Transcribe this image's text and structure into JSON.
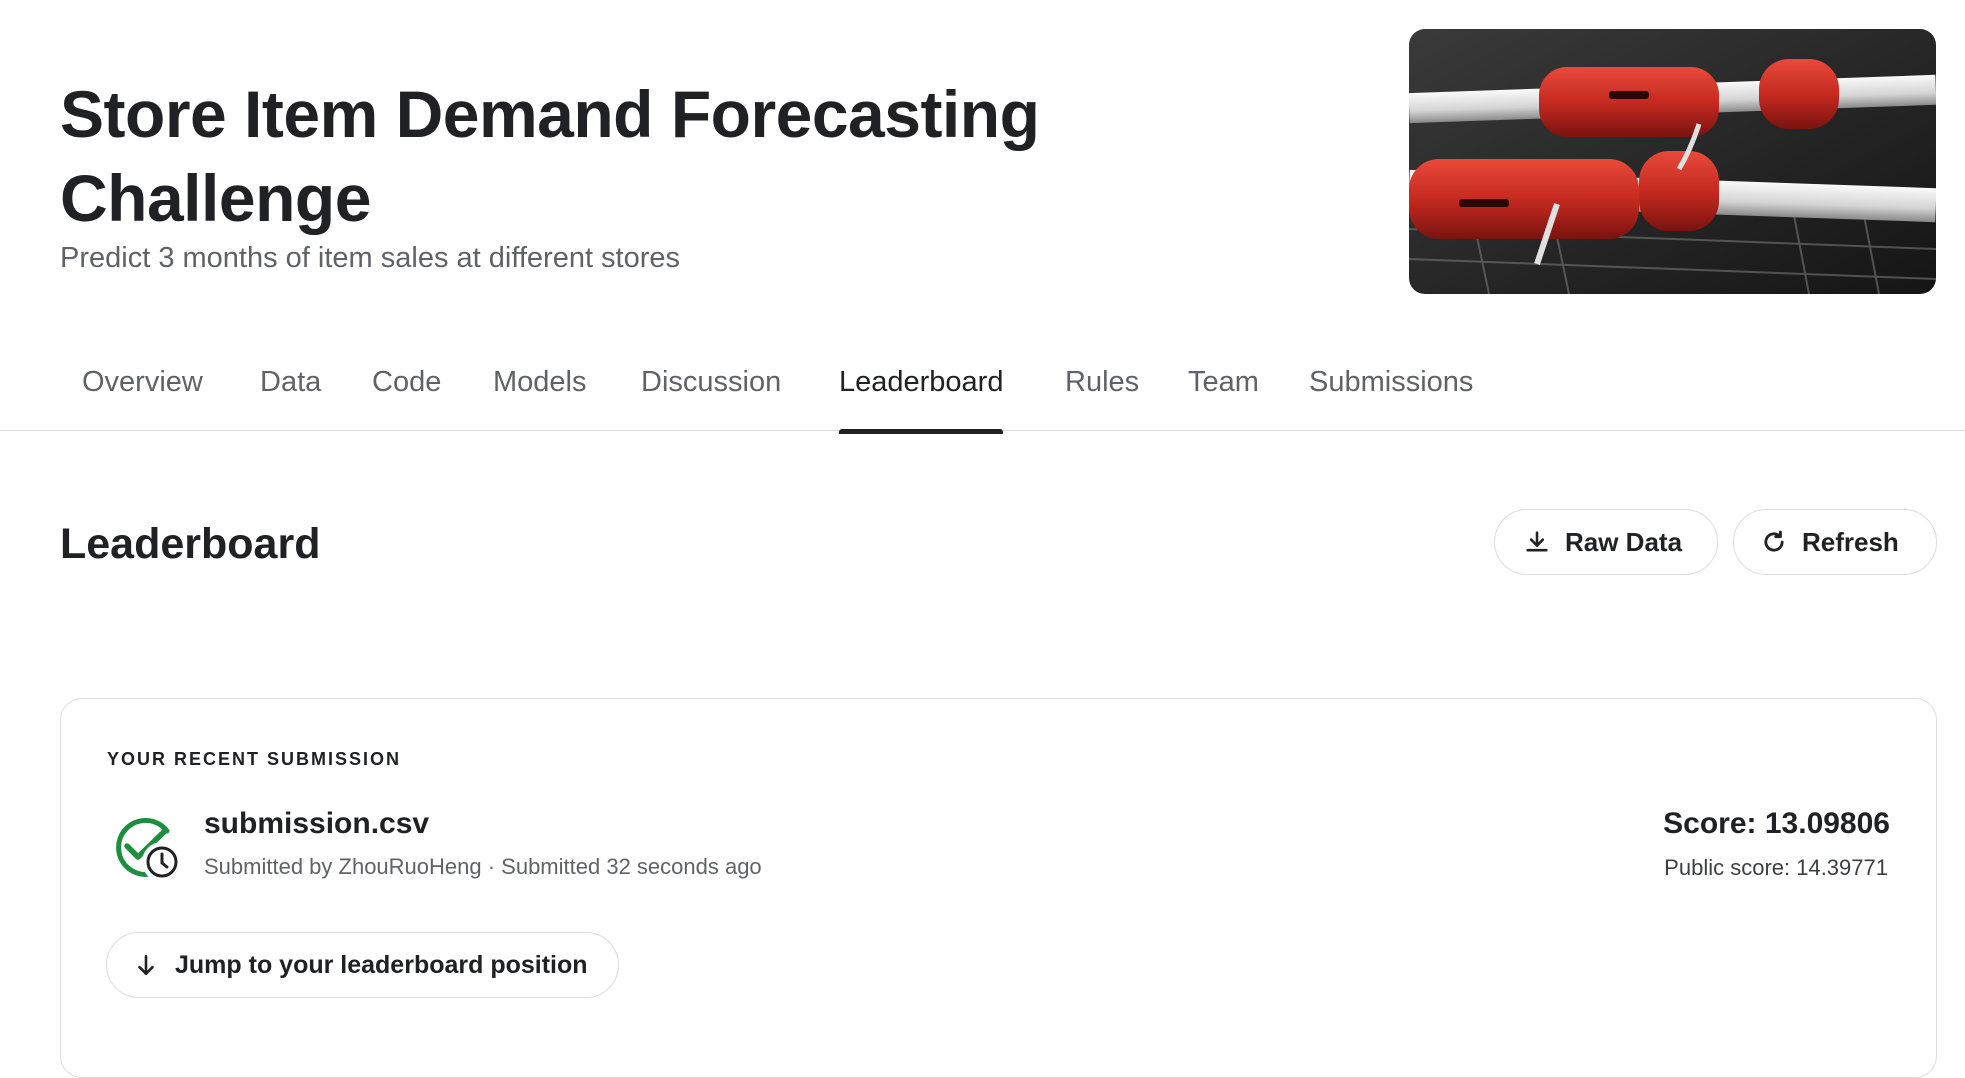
{
  "header": {
    "title": "Store Item Demand Forecasting Challenge",
    "subtitle": "Predict 3 months of item sales at different stores"
  },
  "tabs": [
    {
      "label": "Overview"
    },
    {
      "label": "Data"
    },
    {
      "label": "Code"
    },
    {
      "label": "Models"
    },
    {
      "label": "Discussion"
    },
    {
      "label": "Leaderboard",
      "active": true
    },
    {
      "label": "Rules"
    },
    {
      "label": "Team"
    },
    {
      "label": "Submissions"
    }
  ],
  "leaderboard": {
    "title": "Leaderboard",
    "raw_data_label": "Raw Data",
    "refresh_label": "Refresh"
  },
  "recent_submission": {
    "section_label": "YOUR RECENT SUBMISSION",
    "file_name": "submission.csv",
    "meta": "Submitted by ZhouRuoHeng · Submitted 32 seconds ago",
    "score": "Score: 13.09806",
    "public_score": "Public score: 14.39771",
    "jump_label": "Jump to your leaderboard position"
  },
  "icons": {
    "download": "download-icon",
    "refresh": "refresh-icon",
    "status": "check-circle-icon",
    "clock": "clock-icon",
    "arrow": "arrow-down-icon"
  },
  "colors": {
    "text": "#202124",
    "muted": "#5f6368",
    "border": "#dadce0",
    "success": "#1e8e3e"
  }
}
